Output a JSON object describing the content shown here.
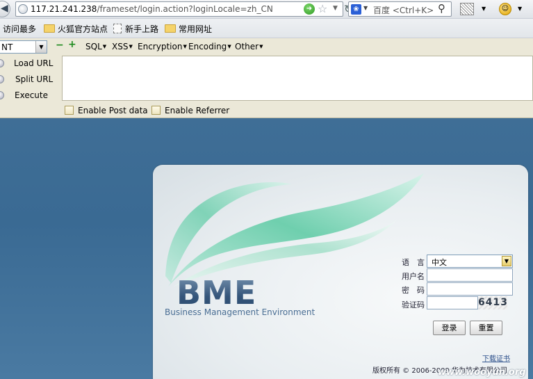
{
  "navbar": {
    "url_host": "117.21.241.238",
    "url_path": "/frameset/login.action?loginLocale=zh_CN",
    "search_engine": "百度",
    "search_placeholder": "<Ctrl+K>"
  },
  "bookmarks": {
    "items": [
      {
        "label": "访问最多"
      },
      {
        "label": "火狐官方站点"
      },
      {
        "label": "新手上路"
      },
      {
        "label": "常用网址"
      }
    ]
  },
  "hackbar": {
    "select_value": "NT",
    "menus": [
      "SQL",
      "XSS",
      "Encryption",
      "Encoding",
      "Other"
    ],
    "actions": [
      "Load URL",
      "Split URL",
      "Execute"
    ],
    "url_value": "",
    "checkboxes": [
      {
        "label": "Enable Post data",
        "checked": false
      },
      {
        "label": "Enable Referrer",
        "checked": false
      }
    ]
  },
  "login": {
    "logo": "BME",
    "subtitle": "Business Management Environment",
    "language_label": "语　言",
    "language_value": "中文",
    "username_label": "用户名",
    "username_value": "",
    "password_label": "密　码",
    "password_value": "",
    "captcha_label": "验证码",
    "captcha_value": "",
    "captcha_text": "6413",
    "login_button": "登录",
    "reset_button": "重置",
    "download_link": "下载证书",
    "copyright": "版权所有 © 2006-2009 华为技术有限公司"
  },
  "watermark": "www.wooyun.org",
  "colors": {
    "background_blue": "#3f6e96",
    "hackbar_bg": "#ebe8d8",
    "logo_blue": "#3e5f80",
    "leaf_green": "#6fcfae"
  }
}
